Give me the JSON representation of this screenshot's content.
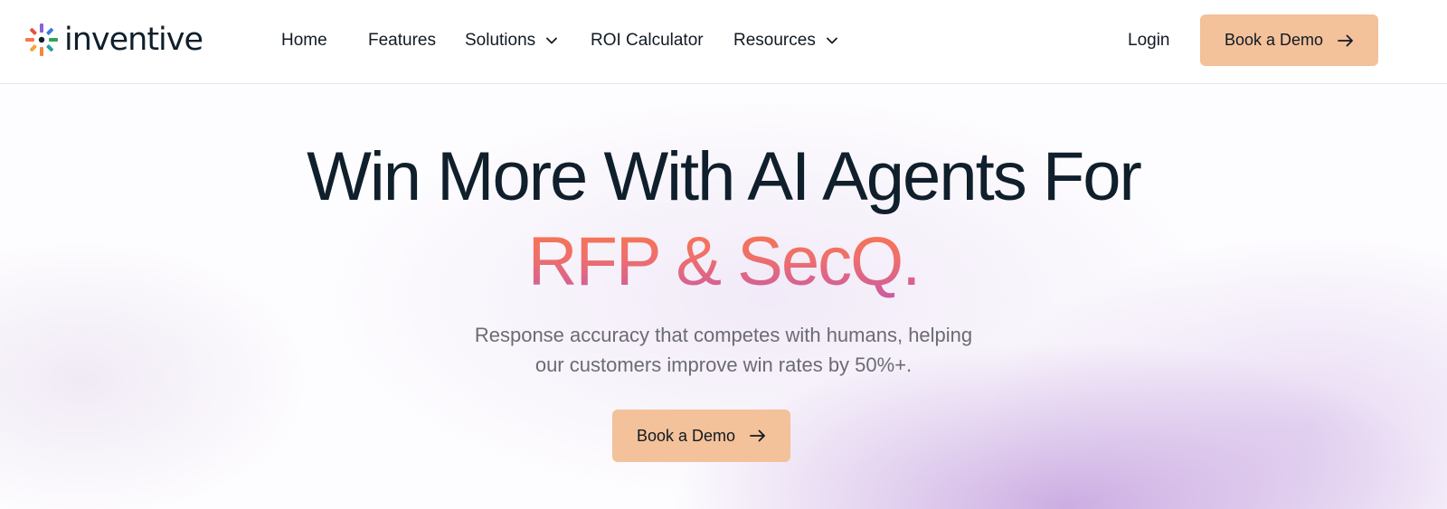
{
  "brand": {
    "name": "inventive"
  },
  "nav": {
    "items": [
      {
        "label": "Home",
        "has_dropdown": false
      },
      {
        "label": "Features",
        "has_dropdown": false
      },
      {
        "label": "Solutions",
        "has_dropdown": true
      },
      {
        "label": "ROI Calculator",
        "has_dropdown": false
      },
      {
        "label": "Resources",
        "has_dropdown": true
      }
    ],
    "login_label": "Login",
    "cta_label": "Book a Demo"
  },
  "hero": {
    "title_line1": "Win More With AI Agents For",
    "title_line2": "RFP & SecQ.",
    "subtitle_line1": "Response accuracy that competes with humans, helping",
    "subtitle_line2": "our customers improve win rates by 50%+.",
    "cta_label": "Book a Demo"
  },
  "colors": {
    "accent_button": "#f3c19a",
    "heading": "#0f1f2b",
    "gradient_start": "#f8764c",
    "gradient_end": "#c85aa6"
  },
  "icons": {
    "logo": "inventive-logo-mark",
    "dropdown": "chevron-down-icon",
    "cta_arrow": "arrow-right-icon"
  }
}
